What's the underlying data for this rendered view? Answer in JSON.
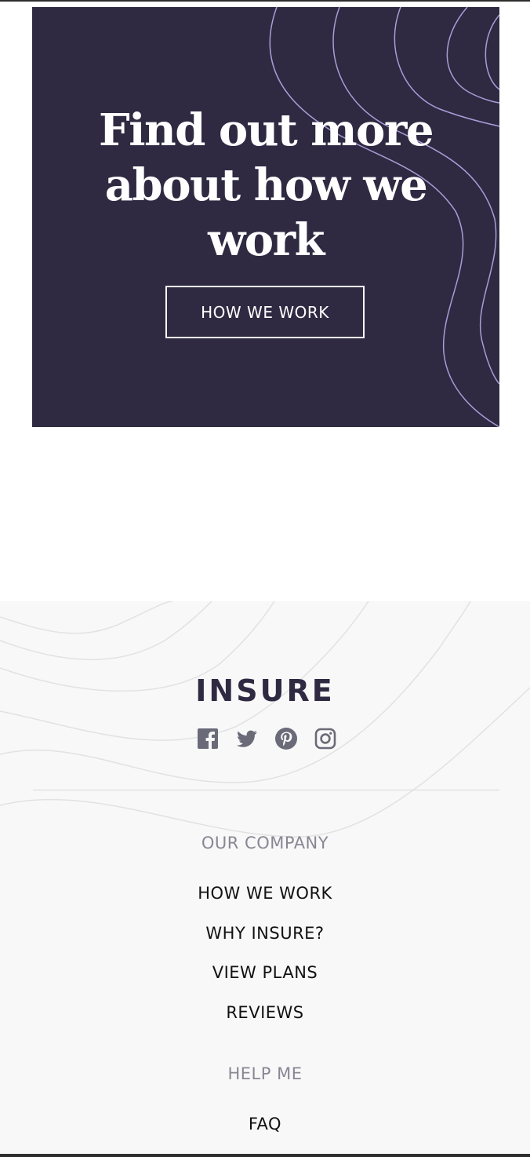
{
  "cta": {
    "title_lines": [
      "Find out more",
      "about how we",
      "work"
    ],
    "button_label": "HOW WE WORK"
  },
  "footer": {
    "logo": "INSURE",
    "social_icons": [
      "facebook-icon",
      "twitter-icon",
      "pinterest-icon",
      "instagram-icon"
    ],
    "sections": [
      {
        "heading": "OUR COMPANY",
        "links": [
          "HOW WE WORK",
          "WHY INSURE?",
          "VIEW PLANS",
          "REVIEWS"
        ]
      },
      {
        "heading": "HELP ME",
        "links": [
          "FAQ"
        ]
      }
    ]
  },
  "colors": {
    "cta_bg": "#2f2a42",
    "wave_line": "#a89ed6",
    "footer_bg": "#f8f8f8",
    "heading_gray": "#8a8794",
    "icon_gray": "#6b6a78"
  }
}
